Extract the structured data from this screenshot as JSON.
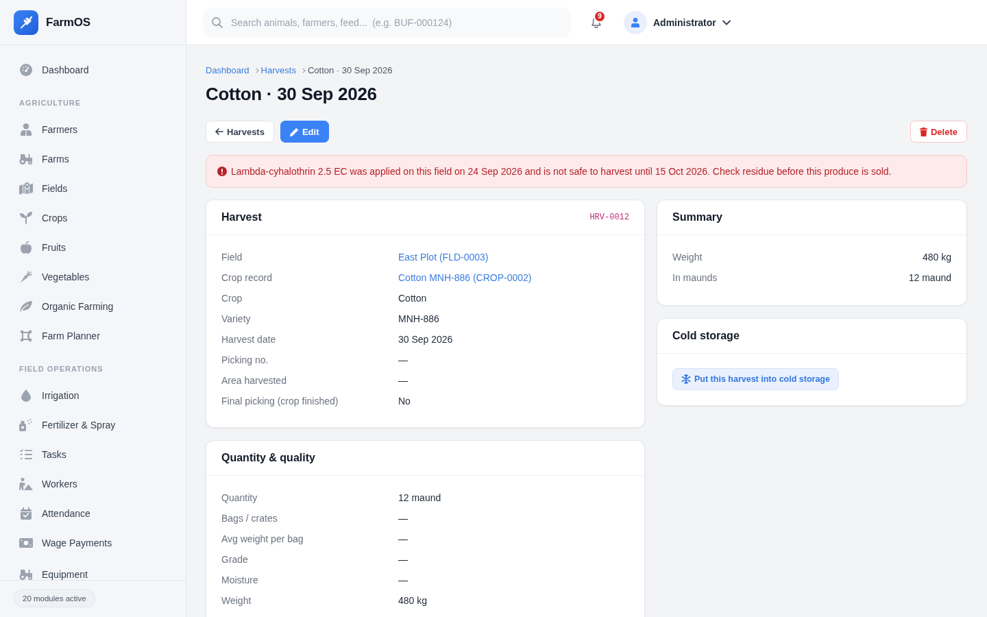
{
  "brand": {
    "name": "FarmOS"
  },
  "sidebar": {
    "sections": [
      {
        "items": [
          {
            "label": "Dashboard",
            "selected": false
          }
        ]
      },
      {
        "title": "AGRICULTURE",
        "items": [
          {
            "label": "Farmers",
            "selected": false
          },
          {
            "label": "Farms",
            "selected": false
          },
          {
            "label": "Fields",
            "selected": false
          },
          {
            "label": "Crops",
            "selected": false
          },
          {
            "label": "Fruits",
            "selected": false
          },
          {
            "label": "Vegetables",
            "selected": false
          },
          {
            "label": "Organic Farming",
            "selected": false
          },
          {
            "label": "Farm Planner",
            "selected": false
          }
        ]
      },
      {
        "title": "FIELD OPERATIONS",
        "items": [
          {
            "label": "Irrigation",
            "selected": false
          },
          {
            "label": "Fertilizer & Spray",
            "selected": false
          },
          {
            "label": "Tasks",
            "selected": false
          },
          {
            "label": "Workers",
            "selected": false
          },
          {
            "label": "Attendance",
            "selected": false
          },
          {
            "label": "Wage Payments",
            "selected": false
          },
          {
            "label": "Equipment",
            "selected": false
          }
        ]
      }
    ],
    "status": "20 modules active"
  },
  "top_bar": {
    "search": {
      "placeholder": "Search animals, farmers, feed...  (e.g. BUF-000124)"
    },
    "notifications": {
      "count": "9"
    },
    "user": {
      "name": "Administrator"
    }
  },
  "breadcrumb": [
    {
      "label": "Dashboard",
      "kind": "link"
    },
    {
      "label": "Harvests",
      "kind": "link"
    },
    {
      "label": "Cotton · 30 Sep 2026",
      "kind": "current"
    }
  ],
  "page_title": "Cotton · 30 Sep 2026",
  "actions": [
    {
      "label": "Harvests",
      "kind": "back"
    },
    {
      "label": "Edit",
      "kind": "primary"
    },
    {
      "label": "Delete",
      "kind": "danger"
    }
  ],
  "alert": {
    "kind": "danger",
    "text": "Lambda-cyhalothrin 2.5 EC was applied on this field on 24 Sep 2026 and is not safe to harvest until 15 Oct 2026. Check residue before this produce is sold."
  },
  "cards": {
    "main": [
      {
        "kind": "details",
        "title": "Harvest",
        "code": "HRV-0012",
        "rows": [
          {
            "label": "Field",
            "value": "East Plot (FLD-0003)",
            "kind": "link"
          },
          {
            "label": "Crop record",
            "value": "Cotton MNH-886 (CROP-0002)",
            "kind": "link"
          },
          {
            "label": "Crop",
            "value": "Cotton",
            "kind": "text"
          },
          {
            "label": "Variety",
            "value": "MNH-886",
            "kind": "text"
          },
          {
            "label": "Harvest date",
            "value": "30 Sep 2026",
            "kind": "text"
          },
          {
            "label": "Picking no.",
            "value": "—",
            "kind": "text"
          },
          {
            "label": "Area harvested",
            "value": "—",
            "kind": "text"
          },
          {
            "label": "Final picking (crop finished)",
            "value": "No",
            "kind": "text"
          }
        ]
      },
      {
        "kind": "details",
        "title": "Quantity & quality",
        "rows": [
          {
            "label": "Quantity",
            "value": "12 maund",
            "kind": "text"
          },
          {
            "label": "Bags / crates",
            "value": "—",
            "kind": "text"
          },
          {
            "label": "Avg weight per bag",
            "value": "—",
            "kind": "text"
          },
          {
            "label": "Grade",
            "value": "—",
            "kind": "text"
          },
          {
            "label": "Moisture",
            "value": "—",
            "kind": "text"
          },
          {
            "label": "Weight",
            "value": "480 kg",
            "kind": "text"
          }
        ]
      }
    ],
    "side": [
      {
        "kind": "summary",
        "title": "Summary",
        "rows": [
          {
            "label": "Weight",
            "value": "480 kg"
          },
          {
            "label": "In maunds",
            "value": "12 maund"
          }
        ]
      },
      {
        "kind": "action",
        "title": "Cold storage",
        "action": "Put this harvest into cold storage"
      }
    ]
  }
}
